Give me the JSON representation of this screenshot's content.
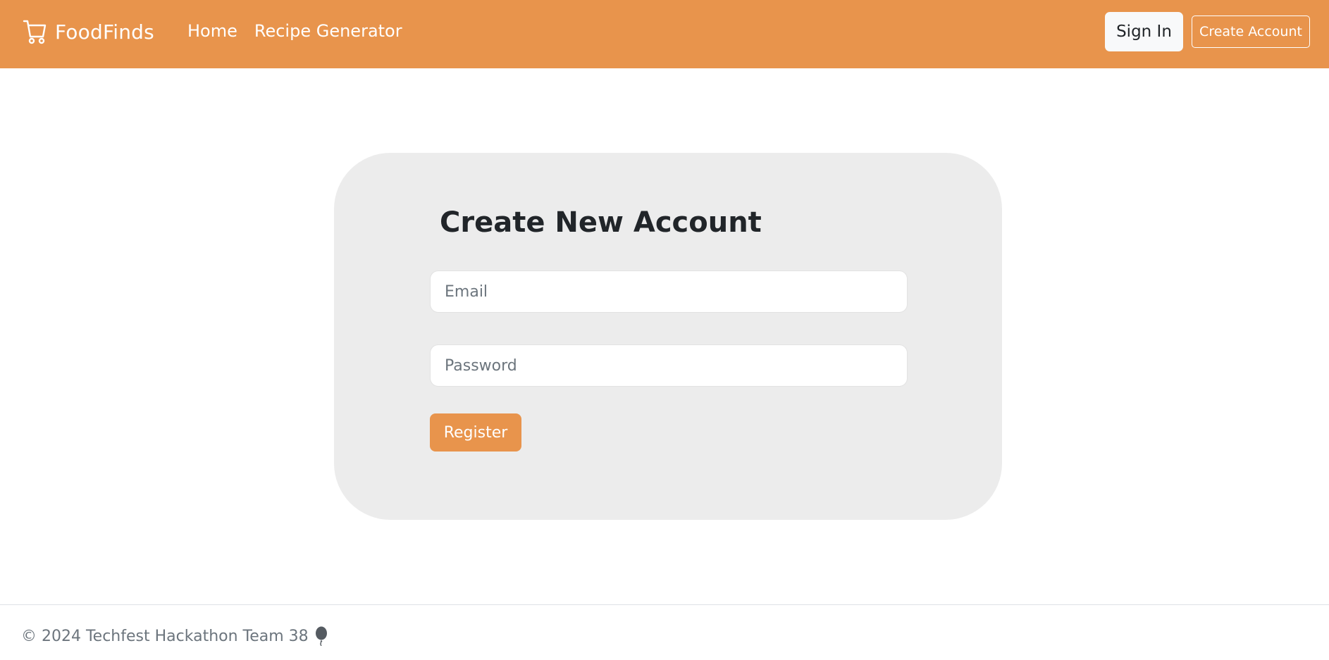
{
  "brand": {
    "name": "FoodFinds",
    "icon": "cart-icon"
  },
  "nav": {
    "links": [
      {
        "label": "Home"
      },
      {
        "label": "Recipe Generator"
      }
    ]
  },
  "auth": {
    "sign_in_label": "Sign In",
    "create_account_label": "Create Account"
  },
  "form": {
    "title": "Create New Account",
    "email_placeholder": "Email",
    "email_value": "",
    "password_placeholder": "Password",
    "password_value": "",
    "submit_label": "Register"
  },
  "footer": {
    "text": "© 2024 Techfest Hackathon Team 38",
    "icon": "balloon-icon"
  },
  "colors": {
    "accent": "#e8944c",
    "card_background": "#ececec",
    "text_dark": "#212529",
    "text_muted": "#6c757d"
  }
}
